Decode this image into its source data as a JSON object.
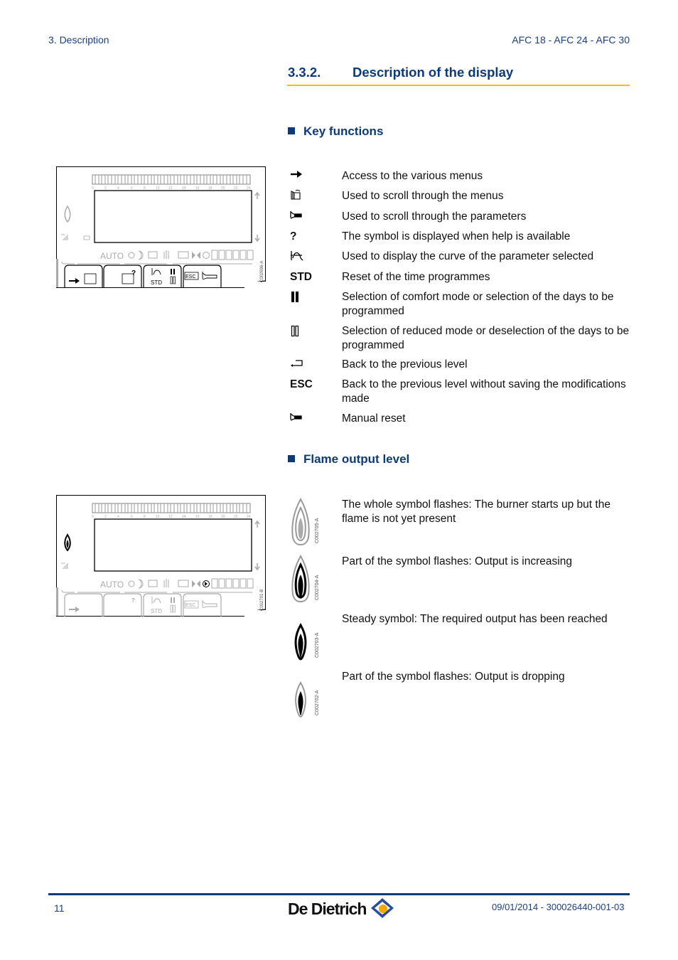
{
  "header": {
    "section": "3.  Description",
    "models": "AFC 18 - AFC 24 - AFC 30"
  },
  "section": {
    "number": "3.3.2.",
    "title": "Description of the display"
  },
  "key_functions": {
    "title": "Key functions",
    "items": [
      {
        "symbol": "arrow-right",
        "symbol_text": "",
        "text": "Access to the various menus"
      },
      {
        "symbol": "menu-scroll-book",
        "symbol_text": "",
        "text": "Used to scroll through the menus"
      },
      {
        "symbol": "horn",
        "symbol_text": "",
        "text": "Used to scroll through the parameters"
      },
      {
        "symbol": "question",
        "symbol_text": "?",
        "text": "The symbol is displayed when help is available"
      },
      {
        "symbol": "curve",
        "symbol_text": "",
        "text": "Used to display the curve of the parameter selected"
      },
      {
        "symbol": "std",
        "symbol_text": "STD",
        "text": "Reset of the time programmes"
      },
      {
        "symbol": "bars-filled",
        "symbol_text": "",
        "text": "Selection of comfort mode or selection of the days to be programmed"
      },
      {
        "symbol": "bars-outline",
        "symbol_text": "",
        "text": "Selection of reduced mode or deselection of the days to be programmed"
      },
      {
        "symbol": "return",
        "symbol_text": "",
        "text": "Back to the previous level"
      },
      {
        "symbol": "esc",
        "symbol_text": "ESC",
        "text": "Back to the previous level without saving the modifications made"
      },
      {
        "symbol": "horn",
        "symbol_text": "",
        "text": "Manual reset"
      }
    ]
  },
  "flame_output": {
    "title": "Flame output level",
    "items": [
      {
        "code": "C002705-A",
        "text": "The whole symbol flashes: The burner starts up but the flame is not yet present"
      },
      {
        "code": "C002704-A",
        "text": "Part of the symbol flashes: Output is increasing"
      },
      {
        "code": "C002703-A",
        "text": "Steady symbol: The required output has been reached"
      },
      {
        "code": "C002702-A",
        "text": "Part of the symbol flashes: Output is dropping"
      }
    ]
  },
  "panels": [
    {
      "code": "C002696-A",
      "hour_ticks": [
        "0",
        "2",
        "4",
        "6",
        "8",
        "10",
        "12",
        "14",
        "16",
        "18",
        "20",
        "22",
        "24"
      ],
      "mode_text": "AUTO",
      "bar_label": "bar",
      "keys": [
        "→ menu",
        "? help",
        "STD",
        "ESC"
      ]
    },
    {
      "code": "C002701-B",
      "hour_ticks": [
        "0",
        "2",
        "4",
        "6",
        "8",
        "10",
        "12",
        "14",
        "16",
        "18",
        "20",
        "22",
        "24"
      ],
      "mode_text": "AUTO",
      "bar_label": "bar",
      "keys": [
        "→",
        "?",
        "STD",
        "ESC"
      ]
    }
  ],
  "footer": {
    "page": "11",
    "brand": "De Dietrich",
    "reference": "09/01/2014 - 300026440-001-03"
  },
  "colors": {
    "heading_blue": "#0d3a78",
    "rule_yellow": "#f2be00",
    "logo_orange": "#f5a800"
  }
}
